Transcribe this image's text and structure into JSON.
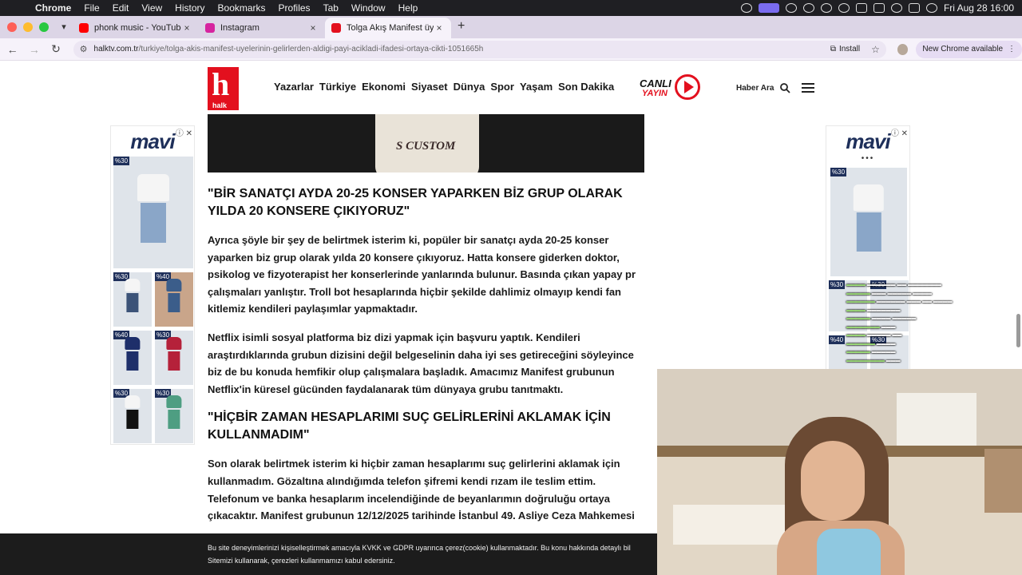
{
  "menubar": {
    "app": "Chrome",
    "items": [
      "File",
      "Edit",
      "View",
      "History",
      "Bookmarks",
      "Profiles",
      "Tab",
      "Window",
      "Help"
    ],
    "clock": "Fri Aug 28  16:00"
  },
  "tabs": [
    {
      "title": "phonk music - YouTube",
      "favicon_color": "#ff0000",
      "active": false
    },
    {
      "title": "Instagram",
      "favicon_color": "#d6249f",
      "active": false
    },
    {
      "title": "Tolga Akış Manifest üyelerinin",
      "favicon_color": "#e3101e",
      "active": true
    }
  ],
  "toolbar": {
    "url_host": "halktv.com.tr",
    "url_path": "/turkiye/tolga-akis-manifest-uyelerinin-gelirlerden-aldigi-payi-acikladi-ifadesi-ortaya-cikti-1051665h",
    "install_label": "Install",
    "update_label": "New Chrome available"
  },
  "site": {
    "logo_text": "halk",
    "nav": [
      "Yazarlar",
      "Türkiye",
      "Ekonomi",
      "Siyaset",
      "Dünya",
      "Spor",
      "Yaşam",
      "Son Dakika"
    ],
    "live_line1": "CANLI",
    "live_line2": "YAYIN",
    "search_label": "Haber Ara"
  },
  "ads": {
    "brand": "mavi",
    "left_tags": [
      "%30",
      "%30",
      "%40",
      "%40",
      "%30",
      "%30",
      "%30"
    ],
    "right_tags": [
      "%30",
      "%30",
      "%30",
      "%40",
      "%30"
    ]
  },
  "hero": {
    "shirt_text": "S CUSTOM"
  },
  "article": {
    "heading1": "\"BİR SANATÇI AYDA 20-25 KONSER YAPARKEN BİZ GRUP OLARAK YILDA 20 KONSERE ÇIKIYORUZ\"",
    "para1": "Ayrıca şöyle bir şey de belirtmek isterim ki, popüler bir sanatçı ayda 20-25 konser yaparken biz grup olarak yılda 20 konsere çıkıyoruz. Hatta konsere giderken doktor, psikolog ve fizyoterapist her konserlerinde yanlarında bulunur. Basında çıkan yapay pr çalışmaları yanlıştır. Troll bot hesaplarında hiçbir şekilde dahlimiz olmayıp kendi fan kitlemiz kendileri paylaşımlar yapmaktadır.",
    "para2": "Netflix isimli sosyal platforma biz dizi yapmak için başvuru yaptık. Kendileri araştırdıklarında grubun dizisini değil belgeselinin daha iyi ses getireceğini söyleyince biz de bu konuda hemfikir olup çalışmalara başladık. Amacımız Manifest grubunun Netflix'in küresel gücünden faydalanarak tüm dünyaya grubu tanıtmaktı.",
    "heading2": "\"HİÇBİR ZAMAN HESAPLARIMI SUÇ GELİRLERİNİ AKLAMAK İÇİN KULLANMADIM\"",
    "para3": "Son olarak belirtmek isterim ki hiçbir zaman hesaplarımı suç gelirlerini aklamak için kullanmadım. Gözaltına alındığımda telefon şifremi kendi rızam ile teslim ettim. Telefonum ve banka hesaplarım incelendiğinde de beyanlarımın doğruluğu ortaya çıkacaktır. Manifest grubunun 12/12/2025 tarihinde İstanbul 49. Asliye Ceza Mahkemesi"
  },
  "cookie": {
    "line1": "Bu site deneyimlerinizi kişiselleştirmek amacıyla KVKK ve GDPR uyarınca çerez(cookie) kullanmaktadır. Bu konu hakkında detaylı bil",
    "line2": "Sitemizi kullanarak, çerezleri kullanmamızı kabul edersiniz."
  }
}
